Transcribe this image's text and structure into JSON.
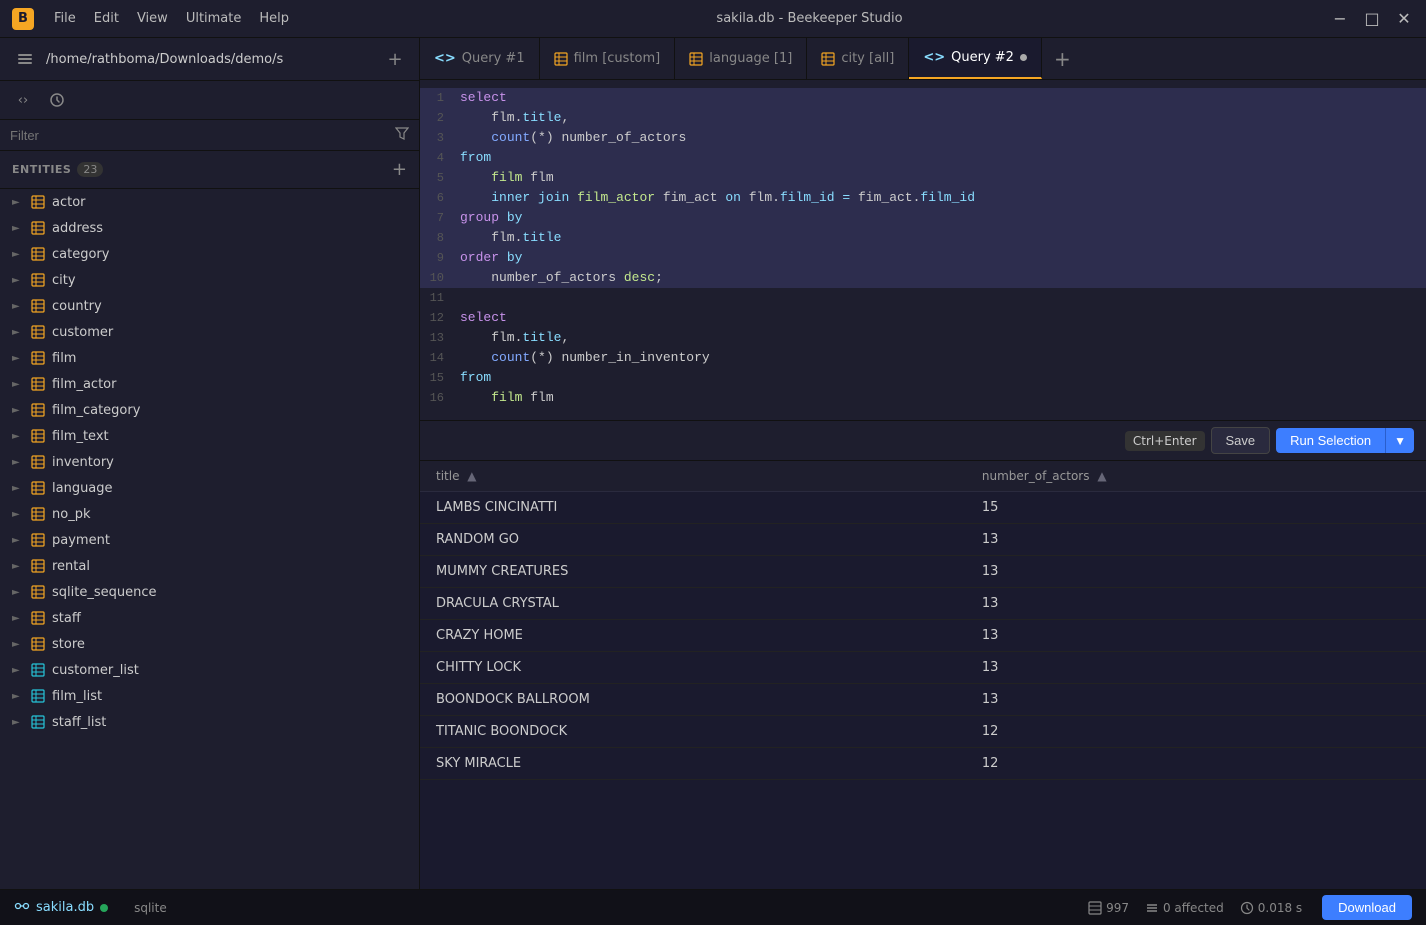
{
  "titlebar": {
    "logo": "B",
    "menu": [
      "File",
      "Edit",
      "View",
      "Ultimate",
      "Help"
    ],
    "title": "sakila.db - Beekeeper Studio",
    "controls": [
      "−",
      "□",
      "✕"
    ]
  },
  "sidebar": {
    "path": "/home/rathboma/Downloads/demo/s",
    "filter_placeholder": "Filter",
    "entities_label": "ENTITIES",
    "entities_count": "23",
    "items": [
      {
        "name": "actor",
        "type": "table"
      },
      {
        "name": "address",
        "type": "table"
      },
      {
        "name": "category",
        "type": "table"
      },
      {
        "name": "city",
        "type": "table"
      },
      {
        "name": "country",
        "type": "table"
      },
      {
        "name": "customer",
        "type": "table"
      },
      {
        "name": "film",
        "type": "table"
      },
      {
        "name": "film_actor",
        "type": "table"
      },
      {
        "name": "film_category",
        "type": "table"
      },
      {
        "name": "film_text",
        "type": "table"
      },
      {
        "name": "inventory",
        "type": "table"
      },
      {
        "name": "language",
        "type": "table"
      },
      {
        "name": "no_pk",
        "type": "table"
      },
      {
        "name": "payment",
        "type": "table"
      },
      {
        "name": "rental",
        "type": "table"
      },
      {
        "name": "sqlite_sequence",
        "type": "table"
      },
      {
        "name": "staff",
        "type": "table"
      },
      {
        "name": "store",
        "type": "table"
      },
      {
        "name": "customer_list",
        "type": "view"
      },
      {
        "name": "film_list",
        "type": "view"
      },
      {
        "name": "staff_list",
        "type": "view"
      }
    ]
  },
  "tabs": [
    {
      "label": "Query #1",
      "type": "query",
      "active": false
    },
    {
      "label": "film [custom]",
      "type": "table",
      "active": false
    },
    {
      "label": "language [1]",
      "type": "table",
      "active": false
    },
    {
      "label": "city [all]",
      "type": "table",
      "active": false
    },
    {
      "label": "Query #2",
      "type": "query",
      "active": true,
      "unsaved": true
    }
  ],
  "editor": {
    "lines": [
      {
        "num": 1,
        "text": "select",
        "type": "kw_line"
      },
      {
        "num": 2,
        "text": "    flm.title,",
        "type": "plain"
      },
      {
        "num": 3,
        "text": "    count(*) number_of_actors",
        "type": "fn_line"
      },
      {
        "num": 4,
        "text": "from",
        "type": "kw_line2"
      },
      {
        "num": 5,
        "text": "    film flm",
        "type": "plain"
      },
      {
        "num": 6,
        "text": "    inner join film_actor fim_act on flm.film_id = fim_act.film_id",
        "type": "join_line"
      },
      {
        "num": 7,
        "text": "group by",
        "type": "kw_line"
      },
      {
        "num": 8,
        "text": "    flm.title",
        "type": "plain"
      },
      {
        "num": 9,
        "text": "order by",
        "type": "kw_line"
      },
      {
        "num": 10,
        "text": "    number_of_actors desc;",
        "type": "plain"
      },
      {
        "num": 11,
        "text": "",
        "type": "plain"
      },
      {
        "num": 12,
        "text": "select",
        "type": "kw_line"
      },
      {
        "num": 13,
        "text": "    flm.title,",
        "type": "plain"
      },
      {
        "num": 14,
        "text": "    count(*) number_in_inventory",
        "type": "fn_line"
      },
      {
        "num": 15,
        "text": "from",
        "type": "kw_line2"
      },
      {
        "num": 16,
        "text": "    film flm",
        "type": "plain"
      }
    ]
  },
  "toolbar": {
    "save_label": "Save",
    "run_label": "Run Selection",
    "shortcut": "Ctrl+Enter"
  },
  "results": {
    "columns": [
      {
        "name": "title",
        "sort": "▲"
      },
      {
        "name": "number_of_actors",
        "sort": "▲"
      }
    ],
    "rows": [
      {
        "title": "LAMBS CINCINATTI",
        "value": "15"
      },
      {
        "title": "RANDOM GO",
        "value": "13"
      },
      {
        "title": "MUMMY CREATURES",
        "value": "13"
      },
      {
        "title": "DRACULA CRYSTAL",
        "value": "13"
      },
      {
        "title": "CRAZY HOME",
        "value": "13"
      },
      {
        "title": "CHITTY LOCK",
        "value": "13"
      },
      {
        "title": "BOONDOCK BALLROOM",
        "value": "13"
      },
      {
        "title": "TITANIC BOONDOCK",
        "value": "12"
      },
      {
        "title": "SKY MIRACLE",
        "value": "12"
      }
    ]
  },
  "statusbar": {
    "db_name": "sakila.db",
    "db_type": "sqlite",
    "rows_count": "997",
    "affected": "0 affected",
    "timing": "0.018 s",
    "download_label": "Download"
  }
}
